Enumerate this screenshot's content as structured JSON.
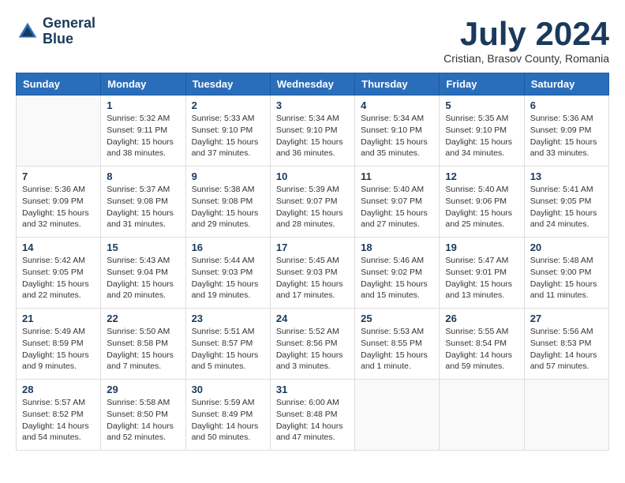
{
  "header": {
    "logo_line1": "General",
    "logo_line2": "Blue",
    "month_year": "July 2024",
    "location": "Cristian, Brasov County, Romania"
  },
  "days_of_week": [
    "Sunday",
    "Monday",
    "Tuesday",
    "Wednesday",
    "Thursday",
    "Friday",
    "Saturday"
  ],
  "weeks": [
    [
      {
        "date": "",
        "info": ""
      },
      {
        "date": "1",
        "info": "Sunrise: 5:32 AM\nSunset: 9:11 PM\nDaylight: 15 hours\nand 38 minutes."
      },
      {
        "date": "2",
        "info": "Sunrise: 5:33 AM\nSunset: 9:10 PM\nDaylight: 15 hours\nand 37 minutes."
      },
      {
        "date": "3",
        "info": "Sunrise: 5:34 AM\nSunset: 9:10 PM\nDaylight: 15 hours\nand 36 minutes."
      },
      {
        "date": "4",
        "info": "Sunrise: 5:34 AM\nSunset: 9:10 PM\nDaylight: 15 hours\nand 35 minutes."
      },
      {
        "date": "5",
        "info": "Sunrise: 5:35 AM\nSunset: 9:10 PM\nDaylight: 15 hours\nand 34 minutes."
      },
      {
        "date": "6",
        "info": "Sunrise: 5:36 AM\nSunset: 9:09 PM\nDaylight: 15 hours\nand 33 minutes."
      }
    ],
    [
      {
        "date": "7",
        "info": "Sunrise: 5:36 AM\nSunset: 9:09 PM\nDaylight: 15 hours\nand 32 minutes."
      },
      {
        "date": "8",
        "info": "Sunrise: 5:37 AM\nSunset: 9:08 PM\nDaylight: 15 hours\nand 31 minutes."
      },
      {
        "date": "9",
        "info": "Sunrise: 5:38 AM\nSunset: 9:08 PM\nDaylight: 15 hours\nand 29 minutes."
      },
      {
        "date": "10",
        "info": "Sunrise: 5:39 AM\nSunset: 9:07 PM\nDaylight: 15 hours\nand 28 minutes."
      },
      {
        "date": "11",
        "info": "Sunrise: 5:40 AM\nSunset: 9:07 PM\nDaylight: 15 hours\nand 27 minutes."
      },
      {
        "date": "12",
        "info": "Sunrise: 5:40 AM\nSunset: 9:06 PM\nDaylight: 15 hours\nand 25 minutes."
      },
      {
        "date": "13",
        "info": "Sunrise: 5:41 AM\nSunset: 9:05 PM\nDaylight: 15 hours\nand 24 minutes."
      }
    ],
    [
      {
        "date": "14",
        "info": "Sunrise: 5:42 AM\nSunset: 9:05 PM\nDaylight: 15 hours\nand 22 minutes."
      },
      {
        "date": "15",
        "info": "Sunrise: 5:43 AM\nSunset: 9:04 PM\nDaylight: 15 hours\nand 20 minutes."
      },
      {
        "date": "16",
        "info": "Sunrise: 5:44 AM\nSunset: 9:03 PM\nDaylight: 15 hours\nand 19 minutes."
      },
      {
        "date": "17",
        "info": "Sunrise: 5:45 AM\nSunset: 9:03 PM\nDaylight: 15 hours\nand 17 minutes."
      },
      {
        "date": "18",
        "info": "Sunrise: 5:46 AM\nSunset: 9:02 PM\nDaylight: 15 hours\nand 15 minutes."
      },
      {
        "date": "19",
        "info": "Sunrise: 5:47 AM\nSunset: 9:01 PM\nDaylight: 15 hours\nand 13 minutes."
      },
      {
        "date": "20",
        "info": "Sunrise: 5:48 AM\nSunset: 9:00 PM\nDaylight: 15 hours\nand 11 minutes."
      }
    ],
    [
      {
        "date": "21",
        "info": "Sunrise: 5:49 AM\nSunset: 8:59 PM\nDaylight: 15 hours\nand 9 minutes."
      },
      {
        "date": "22",
        "info": "Sunrise: 5:50 AM\nSunset: 8:58 PM\nDaylight: 15 hours\nand 7 minutes."
      },
      {
        "date": "23",
        "info": "Sunrise: 5:51 AM\nSunset: 8:57 PM\nDaylight: 15 hours\nand 5 minutes."
      },
      {
        "date": "24",
        "info": "Sunrise: 5:52 AM\nSunset: 8:56 PM\nDaylight: 15 hours\nand 3 minutes."
      },
      {
        "date": "25",
        "info": "Sunrise: 5:53 AM\nSunset: 8:55 PM\nDaylight: 15 hours\nand 1 minute."
      },
      {
        "date": "26",
        "info": "Sunrise: 5:55 AM\nSunset: 8:54 PM\nDaylight: 14 hours\nand 59 minutes."
      },
      {
        "date": "27",
        "info": "Sunrise: 5:56 AM\nSunset: 8:53 PM\nDaylight: 14 hours\nand 57 minutes."
      }
    ],
    [
      {
        "date": "28",
        "info": "Sunrise: 5:57 AM\nSunset: 8:52 PM\nDaylight: 14 hours\nand 54 minutes."
      },
      {
        "date": "29",
        "info": "Sunrise: 5:58 AM\nSunset: 8:50 PM\nDaylight: 14 hours\nand 52 minutes."
      },
      {
        "date": "30",
        "info": "Sunrise: 5:59 AM\nSunset: 8:49 PM\nDaylight: 14 hours\nand 50 minutes."
      },
      {
        "date": "31",
        "info": "Sunrise: 6:00 AM\nSunset: 8:48 PM\nDaylight: 14 hours\nand 47 minutes."
      },
      {
        "date": "",
        "info": ""
      },
      {
        "date": "",
        "info": ""
      },
      {
        "date": "",
        "info": ""
      }
    ]
  ]
}
